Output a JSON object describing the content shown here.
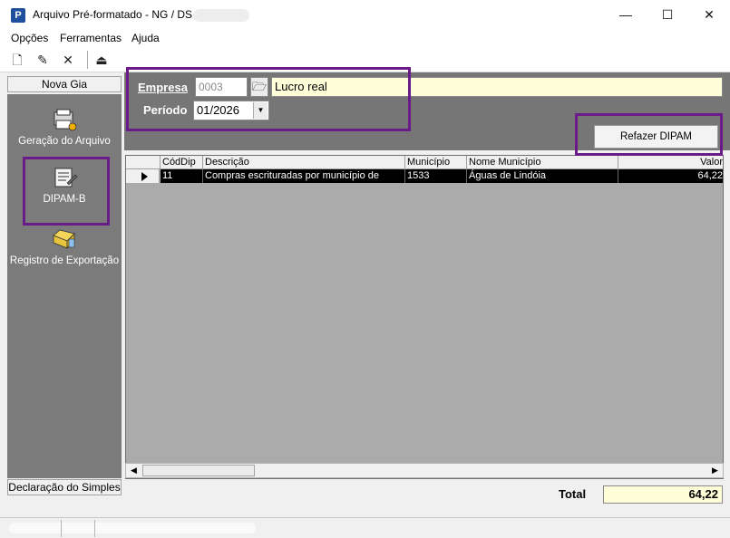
{
  "window": {
    "app_icon_letter": "P",
    "title": "Arquivo Pré-formatado - NG / DS",
    "minimize_glyph": "—",
    "maximize_glyph": "☐",
    "close_glyph": "✕"
  },
  "menu": {
    "items": [
      "Opções",
      "Ferramentas",
      "Ajuda"
    ]
  },
  "toolbar": {
    "buttons": [
      {
        "icon": "new-document-icon",
        "glyph": "🗋"
      },
      {
        "icon": "edit-document-icon",
        "glyph": "✎"
      },
      {
        "icon": "delete-icon",
        "glyph": "✕"
      },
      {
        "icon": "exit-door-icon",
        "glyph": "⏏"
      }
    ]
  },
  "sidebar": {
    "header": "Nova Gia",
    "items": [
      {
        "label": "Geração do Arquivo",
        "icon": "file-generation-icon"
      },
      {
        "label": "DIPAM-B",
        "icon": "dipam-document-icon"
      },
      {
        "label": "Registro de Exportação",
        "icon": "export-register-icon"
      }
    ],
    "footer": "Declaração do Simples"
  },
  "form": {
    "empresa_label": "Empresa",
    "empresa_code": "0003",
    "empresa_name": "Lucro real",
    "periodo_label": "Período",
    "periodo_value": "01/2026",
    "refazer_label": "Refazer DIPAM"
  },
  "grid": {
    "columns": [
      "CódDip",
      "Descrição",
      "Município",
      "Nome Município",
      "Valor"
    ],
    "rows": [
      [
        "11",
        "Compras escrituradas por município de",
        "1533",
        "Águas de Lindóia",
        "64,22"
      ]
    ]
  },
  "totals": {
    "label": "Total",
    "value": "64,22"
  },
  "colors": {
    "panel_gray": "#767676",
    "sidebar_gray": "#7b7b7b",
    "grid_bg": "#ababab",
    "highlight_field": "#fffed8",
    "annotation_box": "#6a1b8a"
  }
}
